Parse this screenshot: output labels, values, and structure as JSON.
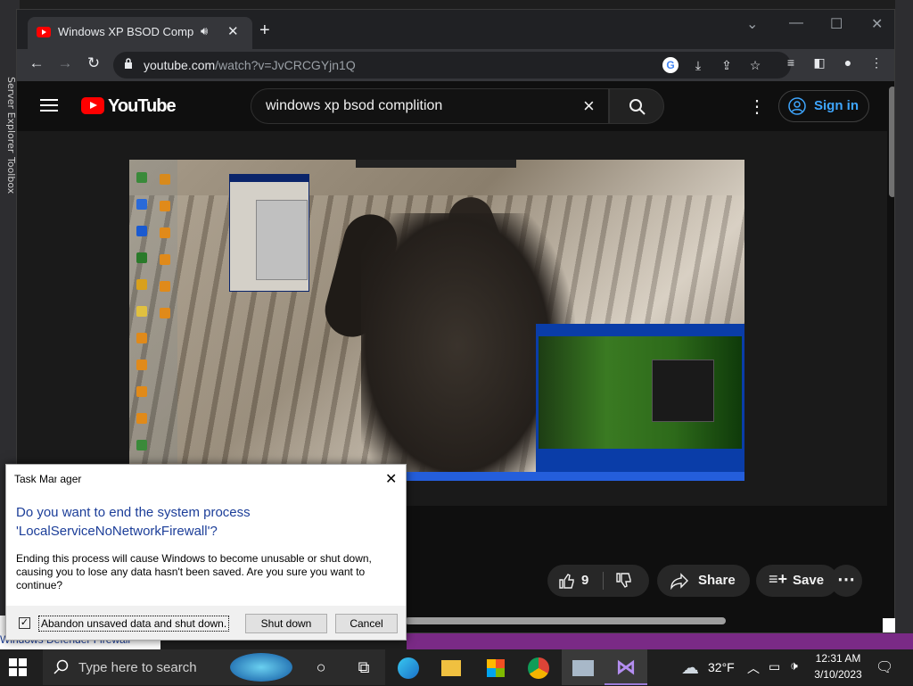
{
  "desktop": {
    "left_labels": [
      "Server Explorer",
      "Toolbox"
    ]
  },
  "browser": {
    "tab": {
      "title": "Windows XP BSOD Compilati",
      "close": "✕"
    },
    "new_tab": "+",
    "window": {
      "minimize": "—",
      "maximize": "☐",
      "close": "✕",
      "tab_search": "⌄"
    },
    "address": {
      "host": "youtube.com",
      "path": "/watch?v=JvCRCGYjn1Q"
    }
  },
  "youtube": {
    "logo_text": "YouTube",
    "search_query": "windows xp bsod complition",
    "sign_in": "Sign in",
    "like_count": "9",
    "share_label": "Share",
    "save_label": "Save"
  },
  "dialog": {
    "title": "Task Manager",
    "heading": "Do you want to end the system process 'LocalServiceNoNetworkFirewall'?",
    "body": "Ending this process will cause Windows to become unusable or shut down, causing you to lose any data hasn't been saved. Are you sure you want to continue?",
    "checkbox_label": "Abandon unsaved data and shut down.",
    "checkbox_checked": true,
    "shutdown_label": "Shut down",
    "cancel_label": "Cancel"
  },
  "behind_window": {
    "text": "Windows Defender Firewall"
  },
  "taskbar": {
    "search_placeholder": "Type here to search",
    "weather": "32°F",
    "time": "12:31 AM",
    "date": "3/10/2023",
    "apps": [
      "cortana-icon",
      "task-view-icon",
      "edge-icon",
      "file-explorer-icon",
      "store-icon",
      "chrome-icon",
      "photos-icon",
      "visual-studio-icon"
    ]
  },
  "colors": {
    "youtube_red": "#ff0000",
    "link_blue": "#3ea6ff",
    "dialog_heading": "#1c3e99",
    "taskbar_accent": "#7a2a86"
  }
}
